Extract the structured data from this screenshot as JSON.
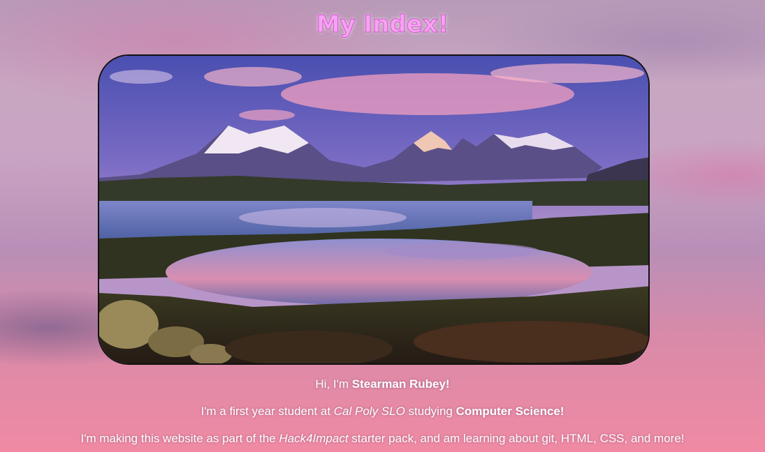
{
  "page": {
    "title": "My Index!"
  },
  "hero_image": {
    "description_icon": "mountain-lake-photo"
  },
  "intro": {
    "line1_prefix": "Hi, I'm ",
    "line1_name": "Stearman Rubey!",
    "line2_prefix": "I'm a first year student at ",
    "line2_school": "Cal Poly SLO",
    "line2_middle": " studying ",
    "line2_major": "Computer Science!",
    "line3_prefix": "I'm making this website as part of the ",
    "line3_program": "Hack4Impact",
    "line3_suffix": " starter pack, and am learning about git, HTML, CSS, and more!"
  },
  "colors": {
    "title": "#f6a3f2",
    "text": "#ffffff"
  }
}
